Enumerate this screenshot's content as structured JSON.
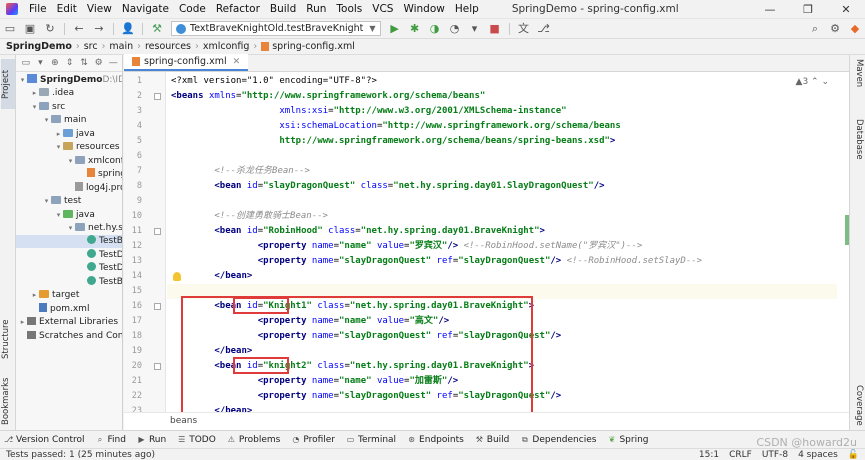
{
  "menubar": {
    "items": [
      "File",
      "Edit",
      "View",
      "Navigate",
      "Code",
      "Refactor",
      "Build",
      "Run",
      "Tools",
      "VCS",
      "Window",
      "Help"
    ],
    "window_title": "SpringDemo - spring-config.xml",
    "controls": [
      "—",
      "❐",
      "✕"
    ]
  },
  "toolbar": {
    "run_config": "TextBraveKnightOld.testBraveKnight"
  },
  "breadcrumb": [
    "SpringDemo",
    "src",
    "main",
    "resources",
    "xmlconfig",
    "spring-config.xml"
  ],
  "left_tabs": {
    "project": "Project",
    "structure": "Structure",
    "bookmarks": "Bookmarks"
  },
  "right_tabs": {
    "maven": "Maven",
    "database": "Database",
    "coverage": "Coverage"
  },
  "project_tree": [
    {
      "label": "SpringDemo",
      "hint": "D:\\IDEDV\\S",
      "icon": "module",
      "indent": 0,
      "arrow": "▾"
    },
    {
      "label": ".idea",
      "icon": "idea",
      "indent": 1,
      "arrow": "▸"
    },
    {
      "label": "src",
      "icon": "folder",
      "indent": 1,
      "arrow": "▾"
    },
    {
      "label": "main",
      "icon": "folder",
      "indent": 2,
      "arrow": "▾"
    },
    {
      "label": "java",
      "icon": "src",
      "indent": 3,
      "arrow": "▸"
    },
    {
      "label": "resources",
      "icon": "res",
      "indent": 3,
      "arrow": "▾"
    },
    {
      "label": "xmlconfig",
      "icon": "folder",
      "indent": 4,
      "arrow": "▾"
    },
    {
      "label": "spring-c",
      "icon": "xml",
      "indent": 5,
      "arrow": ""
    },
    {
      "label": "log4j.prope",
      "icon": "prop",
      "indent": 4,
      "arrow": ""
    },
    {
      "label": "test",
      "icon": "folder",
      "indent": 2,
      "arrow": "▾"
    },
    {
      "label": "java",
      "icon": "test",
      "indent": 3,
      "arrow": "▾"
    },
    {
      "label": "net.hy.sprin",
      "icon": "folder",
      "indent": 4,
      "arrow": "▾"
    },
    {
      "label": "TestBrav",
      "icon": "class",
      "indent": 5,
      "arrow": "",
      "selected": true
    },
    {
      "label": "TestDam",
      "icon": "class",
      "indent": 5,
      "arrow": ""
    },
    {
      "label": "TestDam",
      "icon": "class",
      "indent": 5,
      "arrow": ""
    },
    {
      "label": "TestBrav",
      "icon": "class",
      "indent": 5,
      "arrow": ""
    },
    {
      "label": "target",
      "icon": "tgt",
      "indent": 1,
      "arrow": "▸"
    },
    {
      "label": "pom.xml",
      "icon": "pom",
      "indent": 1,
      "arrow": ""
    },
    {
      "label": "External Libraries",
      "icon": "lib",
      "indent": 0,
      "arrow": "▸"
    },
    {
      "label": "Scratches and Consoles",
      "icon": "lib",
      "indent": 0,
      "arrow": ""
    }
  ],
  "editor": {
    "tab_label": "spring-config.xml",
    "inspection": "▲3  ⌃  ⌄",
    "status_path": "beans",
    "line_numbers": [
      "1",
      "2",
      "3",
      "4",
      "5",
      "6",
      "7",
      "8",
      "9",
      "10",
      "11",
      "12",
      "13",
      "14",
      "15",
      "16",
      "17",
      "18",
      "19",
      "20",
      "21",
      "22",
      "23"
    ],
    "code": {
      "l1": [
        "<?xml version=\"1.0\" encoding=\"UTF-8\"?>"
      ],
      "l2": [
        "<beans ",
        "xmlns",
        "=",
        "\"http://www.springframework.org/schema/beans\""
      ],
      "l3": [
        "xmlns:xsi",
        "=",
        "\"http://www.w3.org/2001/XMLSchema-instance\""
      ],
      "l4": [
        "xsi:schemaLocation",
        "=",
        "\"http://www.springframework.org/schema/beans"
      ],
      "l5": [
        "http://www.springframework.org/schema/beans/spring-beans.xsd\"",
        ">"
      ],
      "l7": [
        "<!--杀龙任务Bean-->"
      ],
      "l8": [
        "<bean ",
        "id",
        "=",
        "\"slayDragonQuest\"",
        " class",
        "=",
        "\"net.hy.spring.day01.SlayDragonQuest\"",
        "/>"
      ],
      "l10": [
        "<!--创建勇敢骑士Bean-->"
      ],
      "l11": [
        "<bean ",
        "id",
        "=",
        "\"RobinHood\"",
        " class",
        "=",
        "\"net.hy.spring.day01.BraveKnight\"",
        ">"
      ],
      "l12": [
        "<property ",
        "name",
        "=",
        "\"name\"",
        " value",
        "=",
        "\"罗宾汉\"",
        "/> ",
        "<!--RobinHood.setName(\"罗宾汉\")-->"
      ],
      "l13": [
        "<property ",
        "name",
        "=",
        "\"slayDragonQuest\"",
        " ref",
        "=",
        "\"slayDragonQuest\"",
        "/> ",
        "<!--RobinHood.setSlayD-->"
      ],
      "l14": [
        "</bean>"
      ],
      "l16": [
        "<bean ",
        "id",
        "=",
        "\"Knight1\"",
        " class",
        "=",
        "\"net.hy.spring.day01.BraveKnight\"",
        ">"
      ],
      "l17": [
        "<property ",
        "name",
        "=",
        "\"name\"",
        " value",
        "=",
        "\"高文\"",
        "/>"
      ],
      "l18": [
        "<property ",
        "name",
        "=",
        "\"slayDragonQuest\"",
        " ref",
        "=",
        "\"slayDragonQuest\"",
        "/>"
      ],
      "l19": [
        "</bean>"
      ],
      "l20": [
        "<bean ",
        "id",
        "=",
        "\"knight2\"",
        " class",
        "=",
        "\"net.hy.spring.day01.BraveKnight\"",
        ">"
      ],
      "l21": [
        "<property ",
        "name",
        "=",
        "\"name\"",
        " value",
        "=",
        "\"加雷斯\"",
        "/>"
      ],
      "l22": [
        "<property ",
        "name",
        "=",
        "\"slayDragonQuest\"",
        " ref",
        "=",
        "\"slayDragonQuest\"",
        "/>"
      ],
      "l23": [
        "</bean>"
      ]
    }
  },
  "bottom_tools": [
    "Version Control",
    "Find",
    "Run",
    "TODO",
    "Problems",
    "Profiler",
    "Terminal",
    "Endpoints",
    "Build",
    "Dependencies",
    "Spring"
  ],
  "status_bar": {
    "message": "Tests passed: 1 (25 minutes ago)",
    "position": "15:1",
    "line_sep": "CRLF",
    "encoding": "UTF-8",
    "indent": "4 spaces"
  },
  "watermark": "CSDN @howard2u",
  "colors": {
    "highlight_box": "#e03b3b",
    "accent": "#4a86d8"
  }
}
